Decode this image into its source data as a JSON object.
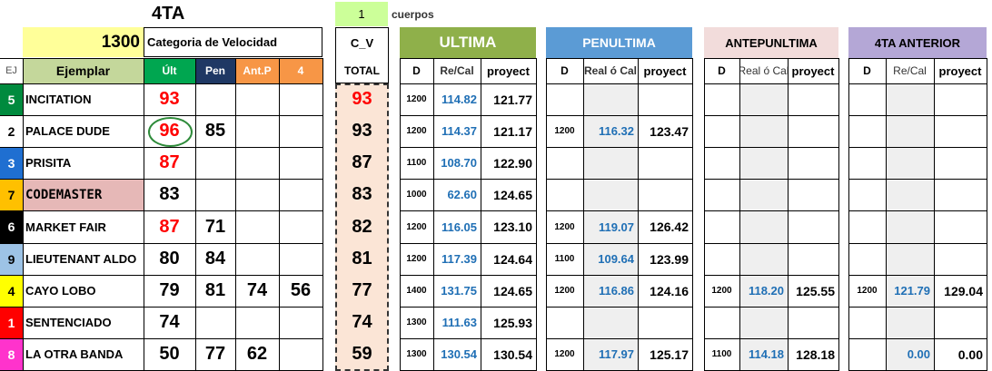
{
  "header": {
    "race_label": "4TA",
    "distance": "1300",
    "category_label": "Categoria de Velocidad",
    "cuerpos_value": "1",
    "cuerpos_label": "cuerpos",
    "cv_label": "C_V"
  },
  "sections": {
    "ultima": "ULTIMA",
    "penultima": "PENULTIMA",
    "antepenultima": "ANTEPUNLTIMA",
    "cuarta": "4TA ANTERIOR"
  },
  "columns": {
    "ej": "EJ",
    "ejemplar": "Ejemplar",
    "ult": "Últ",
    "pen": "Pen",
    "antp": "Ant.P",
    "four": "4",
    "total": "TOTAL",
    "d1": "D",
    "recal1": "Re/Cal",
    "proy1": "proyect",
    "d2": "D",
    "recal2": "Real ó Cal",
    "proy2": "proyect",
    "d3": "D",
    "recal3": "Real ó Cal",
    "proy3": "proyect",
    "d4": "D",
    "recal4": "Re/Cal",
    "proy4": "proyect"
  },
  "colors": {
    "header_yellow": "#ffff99",
    "cuerpos_green": "#ccff99",
    "ultima_green": "#8fb04a",
    "penultima_blue": "#5b9bd5",
    "antepenultima_pink": "#f2dcdb",
    "cuarta_purple": "#b4a7d6",
    "ult_header_green": "#00a650",
    "pen_header_navy": "#1f3864",
    "antp_header_orange": "#f79646",
    "total_bg": "#fbe5d6",
    "ejemplar_header": "#c4d79b"
  },
  "rows": [
    {
      "num": "5",
      "numbg": "#008a3e",
      "numcolor": "#ffffff",
      "name": "INCITATION",
      "ult": "93",
      "ultred": true,
      "pen": "",
      "antp": "",
      "four": "",
      "total": "93",
      "totalred": true,
      "d1": "1200",
      "rc1": "114.82",
      "p1": "121.77",
      "d2": "",
      "rc2": "",
      "p2": "",
      "d3": "",
      "rc3": "",
      "p3": "",
      "d4": "",
      "rc4": "",
      "p4": ""
    },
    {
      "num": "2",
      "numbg": "#ffffff",
      "numcolor": "#000000",
      "name": "PALACE DUDE",
      "ult": "96",
      "ultred": true,
      "pen": "85",
      "antp": "",
      "four": "",
      "total": "93",
      "totalred": false,
      "d1": "1200",
      "rc1": "114.37",
      "p1": "121.17",
      "d2": "1200",
      "rc2": "116.32",
      "p2": "123.47",
      "d3": "",
      "rc3": "",
      "p3": "",
      "d4": "",
      "rc4": "",
      "p4": ""
    },
    {
      "num": "3",
      "numbg": "#1f6fd1",
      "numcolor": "#ffffff",
      "name": "PRISITA",
      "ult": "87",
      "ultred": true,
      "pen": "",
      "antp": "",
      "four": "",
      "total": "87",
      "totalred": false,
      "d1": "1100",
      "rc1": "108.70",
      "p1": "122.90",
      "d2": "",
      "rc2": "",
      "p2": "",
      "d3": "",
      "rc3": "",
      "p3": "",
      "d4": "",
      "rc4": "",
      "p4": ""
    },
    {
      "num": "7",
      "numbg": "#ffc000",
      "numcolor": "#000000",
      "name": "CODEMASTER",
      "namebg": "#e6b8b7",
      "ult": "83",
      "ultred": false,
      "pen": "",
      "antp": "",
      "four": "",
      "total": "83",
      "totalred": false,
      "d1": "1000",
      "rc1": "62.60",
      "p1": "124.65",
      "d2": "",
      "rc2": "",
      "p2": "",
      "d3": "",
      "rc3": "",
      "p3": "",
      "d4": "",
      "rc4": "",
      "p4": ""
    },
    {
      "num": "6",
      "numbg": "#000000",
      "numcolor": "#ffffff",
      "name": "MARKET FAIR",
      "ult": "87",
      "ultred": true,
      "pen": "71",
      "antp": "",
      "four": "",
      "total": "82",
      "totalred": false,
      "d1": "1200",
      "rc1": "116.05",
      "p1": "123.10",
      "d2": "1200",
      "rc2": "119.07",
      "p2": "126.42",
      "d3": "",
      "rc3": "",
      "p3": "",
      "d4": "",
      "rc4": "",
      "p4": ""
    },
    {
      "num": "9",
      "numbg": "#9dc3e6",
      "numcolor": "#000000",
      "name": "LIEUTENANT ALDO",
      "ult": "80",
      "ultred": false,
      "pen": "84",
      "antp": "",
      "four": "",
      "total": "81",
      "totalred": false,
      "d1": "1200",
      "rc1": "117.39",
      "p1": "124.64",
      "d2": "1100",
      "rc2": "109.64",
      "p2": "123.99",
      "d3": "",
      "rc3": "",
      "p3": "",
      "d4": "",
      "rc4": "",
      "p4": ""
    },
    {
      "num": "4",
      "numbg": "#ffff00",
      "numcolor": "#000000",
      "name": "CAYO LOBO",
      "ult": "79",
      "ultred": false,
      "pen": "81",
      "antp": "74",
      "four": "56",
      "total": "77",
      "totalred": false,
      "d1": "1400",
      "rc1": "131.75",
      "p1": "124.65",
      "d2": "1200",
      "rc2": "116.86",
      "p2": "124.16",
      "d3": "1200",
      "rc3": "118.20",
      "p3": "125.55",
      "d4": "1200",
      "rc4": "121.79",
      "p4": "129.04"
    },
    {
      "num": "1",
      "numbg": "#ff0000",
      "numcolor": "#ffffff",
      "name": "SENTENCIADO",
      "ult": "74",
      "ultred": false,
      "pen": "",
      "antp": "",
      "four": "",
      "total": "74",
      "totalred": false,
      "d1": "1300",
      "rc1": "111.63",
      "p1": "125.93",
      "d2": "",
      "rc2": "",
      "p2": "",
      "d3": "",
      "rc3": "",
      "p3": "",
      "d4": "",
      "rc4": "",
      "p4": ""
    },
    {
      "num": "8",
      "numbg": "#ff33cc",
      "numcolor": "#ffffff",
      "name": "LA OTRA BANDA",
      "ult": "50",
      "ultred": false,
      "pen": "77",
      "antp": "62",
      "four": "",
      "total": "59",
      "totalred": false,
      "d1": "1300",
      "rc1": "130.54",
      "p1": "130.54",
      "d2": "1200",
      "rc2": "117.97",
      "p2": "125.17",
      "d3": "1100",
      "rc3": "114.18",
      "p3": "128.18",
      "d4": "",
      "rc4": "0.00",
      "p4": "0.00"
    }
  ]
}
